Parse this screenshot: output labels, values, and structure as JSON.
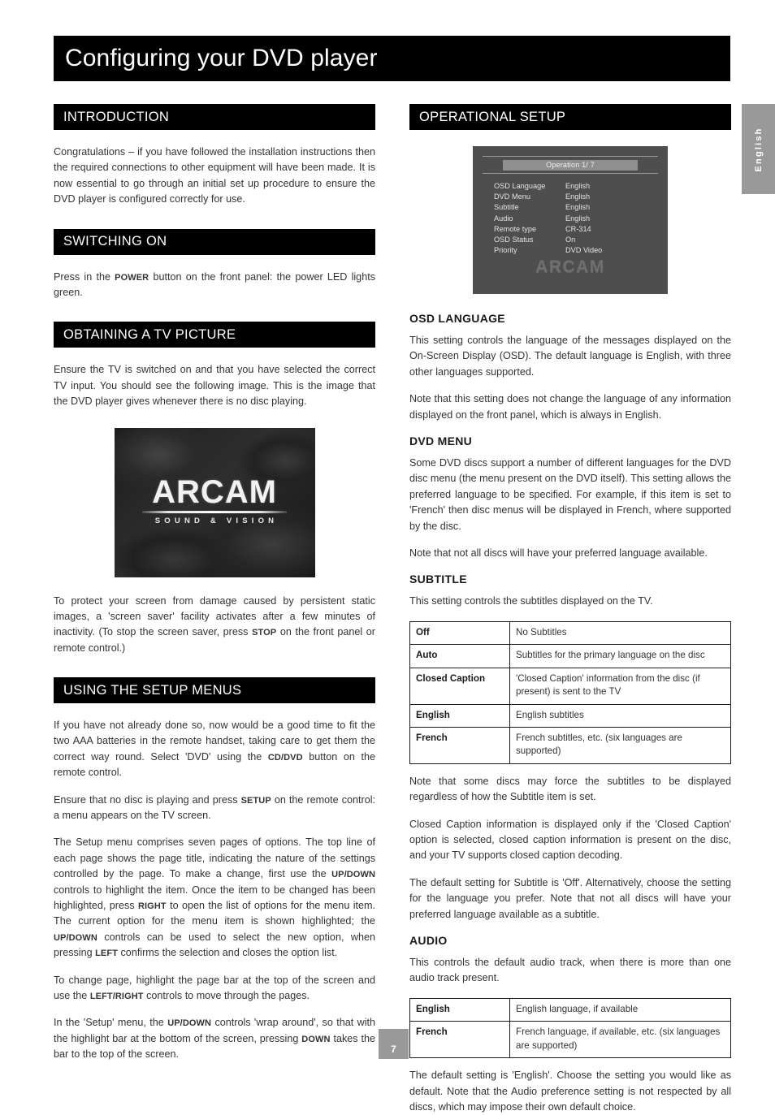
{
  "document": {
    "title": "Configuring your DVD player",
    "page_number": "7",
    "side_tab": "English"
  },
  "left_column": {
    "introduction": {
      "heading": "INTRODUCTION",
      "p1": "Congratulations – if you have followed the installation instructions then the required connections to other equipment will have been made. It is now essential to go through an initial set up procedure to ensure the DVD player is configured correctly for use."
    },
    "switching_on": {
      "heading": "SWITCHING ON",
      "p1_a": "Press in the ",
      "p1_kw": "POWER",
      "p1_b": " button on the front panel: the power LED lights green."
    },
    "obtaining_tv_picture": {
      "heading": "OBTAINING A TV PICTURE",
      "p1": "Ensure the TV is switched on and that you have selected the correct TV input. You should see the following image. This is the image that the DVD player gives whenever there is no disc playing.",
      "image": {
        "logo_main": "ARCAM",
        "logo_sub": "SOUND & VISION"
      },
      "p2_a": "To protect your screen from damage caused by persistent static images, a 'screen saver' facility activates after a few minutes of inactivity. (To stop the screen saver, press ",
      "p2_kw": "STOP",
      "p2_b": " on the front panel or remote control.)"
    },
    "using_setup_menus": {
      "heading": "USING THE SETUP MENUS",
      "p1_a": "If you have not already done so, now would be a good time to fit the two AAA batteries in the remote handset, taking care to get them the correct way round. Select 'DVD' using the ",
      "p1_kw": "CD/DVD",
      "p1_b": " button on the remote control.",
      "p2_a": "Ensure that no disc is playing and press ",
      "p2_kw": "SETUP",
      "p2_b": " on the remote control: a menu appears on the TV screen.",
      "p3_a": "The Setup menu comprises seven pages of options. The top line of each page shows the page title, indicating the nature of the settings controlled by the page. To make a change, first use the ",
      "p3_kw1": "UP/DOWN",
      "p3_b": " controls to highlight the item. Once the item to be changed has been highlighted, press ",
      "p3_kw2": "RIGHT",
      "p3_c": " to open the list of options for the menu item. The current option for the menu item is shown highlighted; the ",
      "p3_kw3": "UP/DOWN",
      "p3_d": " controls can be used to select the new option, when pressing ",
      "p3_kw4": "LEFT",
      "p3_e": " confirms the selection and closes the option list.",
      "p4_a": "To change page, highlight the page bar at the top of the screen and use the ",
      "p4_kw": "LEFT/RIGHT",
      "p4_b": " controls to move through the pages.",
      "p5_a": "In the 'Setup' menu, the ",
      "p5_kw1": "UP/DOWN",
      "p5_b": " controls 'wrap around', so that with the highlight bar at the bottom of the screen, pressing ",
      "p5_kw2": "DOWN",
      "p5_c": " takes the bar to the top of the screen."
    }
  },
  "right_column": {
    "operational_setup": {
      "heading": "OPERATIONAL SETUP"
    },
    "osd_screen": {
      "title_bar": "Operation 1/ 7",
      "brand": "ARCAM",
      "rows": [
        {
          "key": "OSD Language",
          "value": "English"
        },
        {
          "key": "DVD Menu",
          "value": "English"
        },
        {
          "key": "Subtitle",
          "value": "English"
        },
        {
          "key": "Audio",
          "value": "English"
        },
        {
          "key": "Remote type",
          "value": "CR-314"
        },
        {
          "key": "OSD Status",
          "value": "On"
        },
        {
          "key": "Priority",
          "value": "DVD Video"
        }
      ]
    },
    "osd_language": {
      "heading": "OSD LANGUAGE",
      "p1": "This setting controls the language of the messages displayed on the On-Screen Display (OSD). The default language is English, with three other languages supported.",
      "p2": "Note that this setting does not change the language of any information displayed on the front panel, which is always in English."
    },
    "dvd_menu": {
      "heading": "DVD MENU",
      "p1": "Some DVD discs support a number of different languages for the DVD disc menu (the menu present on the DVD itself). This setting allows the preferred language to be specified. For example, if this item is set to 'French' then disc menus will be displayed in French, where supported by the disc.",
      "p2": "Note that not all discs will have your preferred language available."
    },
    "subtitle": {
      "heading": "SUBTITLE",
      "p1": "This setting controls the subtitles displayed on the TV.",
      "table": [
        {
          "option": "Off",
          "description": "No Subtitles"
        },
        {
          "option": "Auto",
          "description": "Subtitles for the primary language on the disc"
        },
        {
          "option": "Closed Caption",
          "description": "'Closed Caption' information from the disc (if present) is sent to the TV"
        },
        {
          "option": "English",
          "description": "English subtitles"
        },
        {
          "option": "French",
          "description": "French subtitles, etc. (six languages are supported)"
        }
      ],
      "p2": "Note that some discs may force the subtitles to be displayed regardless of how the Subtitle item is set.",
      "p3": "Closed Caption information is displayed only if the 'Closed Caption' option is selected, closed caption information is present on the disc, and your TV supports closed caption decoding.",
      "p4": "The default setting for Subtitle is 'Off'. Alternatively, choose the setting for the language you prefer. Note that not all discs will have your preferred language available as a subtitle."
    },
    "audio": {
      "heading": "AUDIO",
      "p1": "This controls the default audio track, when there is more than one audio track present.",
      "table": [
        {
          "option": "English",
          "description": "English language, if available"
        },
        {
          "option": "French",
          "description": "French language, if available, etc. (six languages are supported)"
        }
      ],
      "p2": "The default setting is 'English'. Choose the setting you would like as default. Note that the Audio preference setting is not respected by all discs, which may impose their own default choice."
    }
  }
}
